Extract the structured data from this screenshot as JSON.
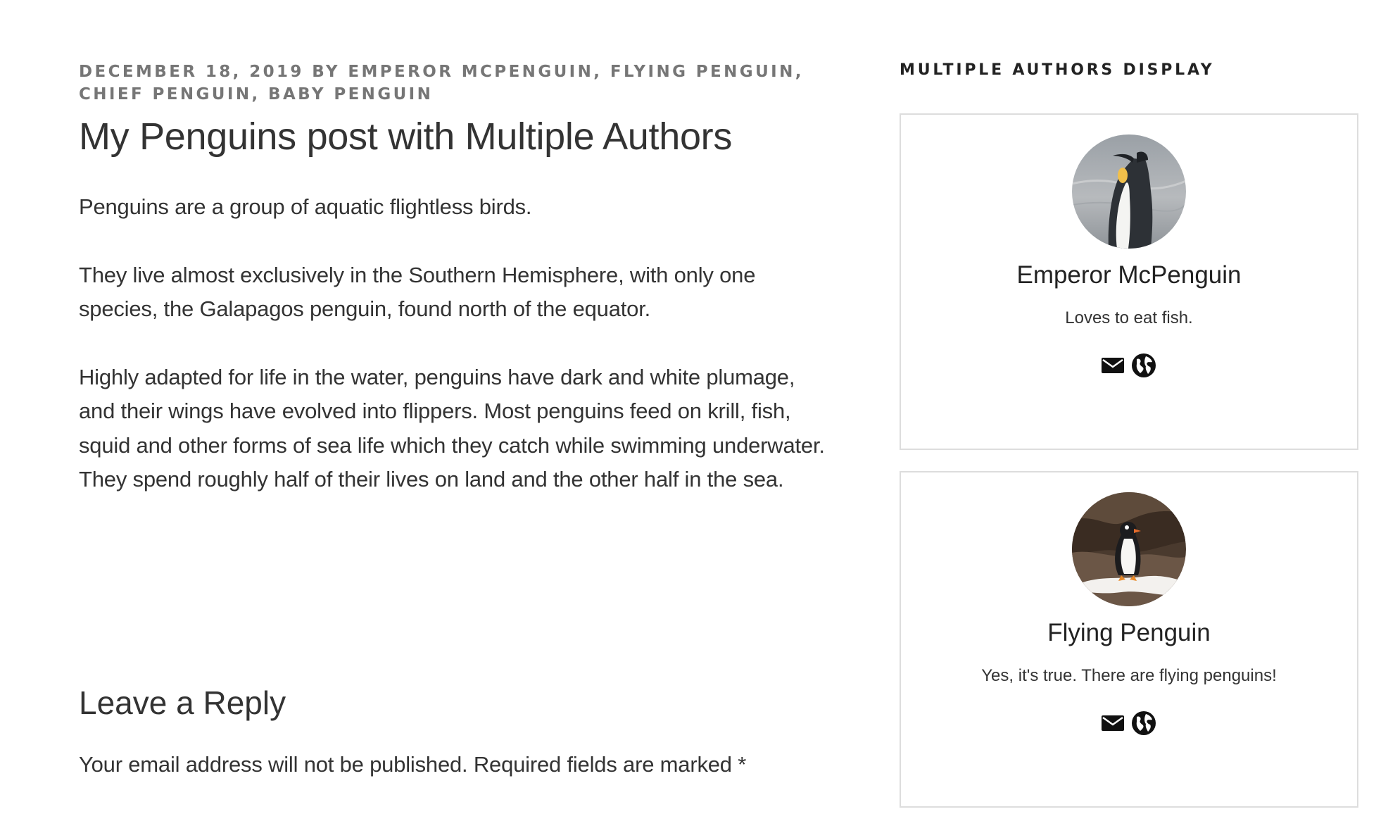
{
  "post": {
    "date": "December 18, 2019",
    "by": "by",
    "authors": [
      "Emperor McPenguin",
      "Flying Penguin",
      "Chief Penguin",
      "Baby Penguin"
    ],
    "separator": ", ",
    "title": "My Penguins post with Multiple Authors",
    "paragraphs": [
      "Penguins are a group of aquatic flightless birds.",
      "They live almost exclusively in the Southern Hemisphere, with only one species, the Galapagos penguin, found north of the equator.",
      "Highly adapted for life in the water, penguins have dark and white plumage, and their wings have evolved into flippers. Most penguins feed on krill, fish, squid and other forms of sea life which they catch while swimming underwater. They spend roughly half of their lives on land and the other half in the sea."
    ]
  },
  "comments": {
    "title": "Leave a Reply",
    "notes": "Your email address will not be published. Required fields are marked *"
  },
  "sidebar": {
    "widget_title": "Multiple Authors Display",
    "authors": [
      {
        "name": "Emperor McPenguin",
        "bio": "Loves to eat fish.",
        "links": [
          "mail-icon",
          "globe-icon"
        ]
      },
      {
        "name": "Flying Penguin",
        "bio": "Yes, it's true. There are flying penguins!",
        "links": [
          "mail-icon",
          "globe-icon"
        ]
      }
    ]
  },
  "colors": {
    "meta_gray": "#767676",
    "text": "#333333",
    "border": "#dddddd"
  }
}
